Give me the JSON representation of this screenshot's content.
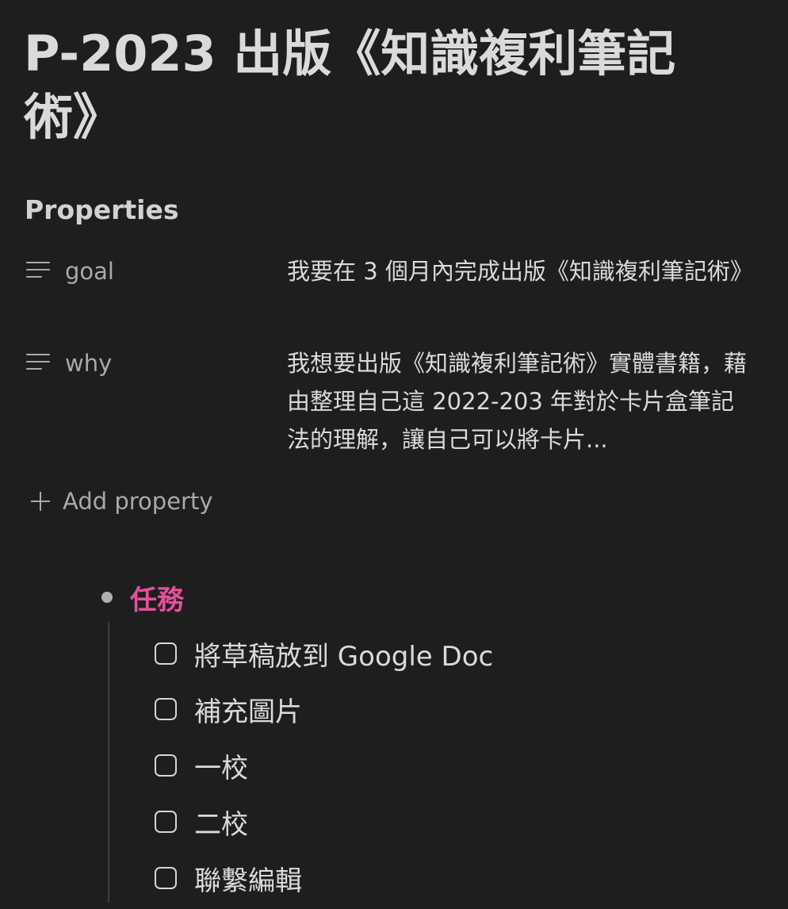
{
  "page": {
    "title": "P-2023 出版《知識複利筆記術》"
  },
  "properties": {
    "heading": "Properties",
    "items": [
      {
        "icon": "text-lines-icon",
        "key": "goal",
        "value": "我要在 3 個月內完成出版《知識複利筆記術》"
      },
      {
        "icon": "text-lines-icon",
        "key": "why",
        "value": "我想要出版《知識複利筆記術》實體書籍，藉由整理自己這 2022-203 年對於卡片盒筆記法的理解，讓自己可以將卡片..."
      }
    ],
    "add_label": "Add property"
  },
  "tasks": {
    "heading": "任務",
    "heading_color": "#e5509d",
    "items": [
      {
        "label": "將草稿放到 Google Doc",
        "checked": false
      },
      {
        "label": "補充圖片",
        "checked": false
      },
      {
        "label": "一校",
        "checked": false
      },
      {
        "label": "二校",
        "checked": false
      },
      {
        "label": "聯繫編輯",
        "checked": false
      }
    ]
  }
}
